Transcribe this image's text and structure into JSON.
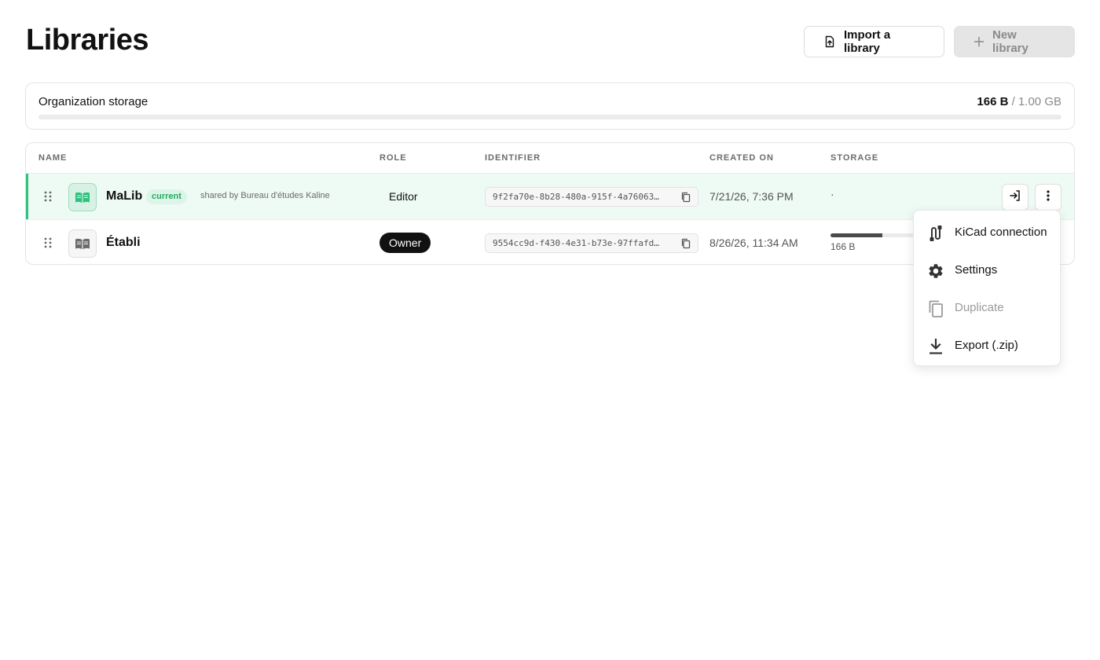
{
  "page": {
    "title": "Libraries"
  },
  "header": {
    "import_label": "Import a library",
    "new_label": "New library"
  },
  "storage": {
    "label": "Organization storage",
    "used": "166 B",
    "total_text": "/ 1.00 GB",
    "used_fraction": 2e-07
  },
  "table": {
    "columns": [
      "NAME",
      "ROLE",
      "IDENTIFIER",
      "CREATED ON",
      "STORAGE"
    ],
    "rows": [
      {
        "name": "MaLib",
        "badge": "current",
        "shared_by": "shared by Bureau d'études Kaline",
        "role": "Editor",
        "identifier": "9f2fa70e-8b28-480a-915f-4a76063…",
        "created": "7/21/26, 7:36 PM",
        "storage": "·"
      },
      {
        "name": "Établi",
        "role": "Owner",
        "identifier": "9554cc9d-f430-4e31-b73e-97ffafd…",
        "created": "8/26/26, 11:34 AM",
        "storage": "166 B",
        "storage_fraction": 0.6
      }
    ]
  },
  "menu": {
    "items": [
      {
        "label": "KiCad connection",
        "icon": "kicad-connection-icon",
        "disabled": false
      },
      {
        "label": "Settings",
        "icon": "gear-icon",
        "disabled": false
      },
      {
        "label": "Duplicate",
        "icon": "duplicate-icon",
        "disabled": true
      },
      {
        "label": "Export (.zip)",
        "icon": "download-icon",
        "disabled": false
      }
    ]
  },
  "colors": {
    "accent": "#2ec27e",
    "current_row_bg": "#eefaf4",
    "owner_badge_bg": "#111111"
  }
}
